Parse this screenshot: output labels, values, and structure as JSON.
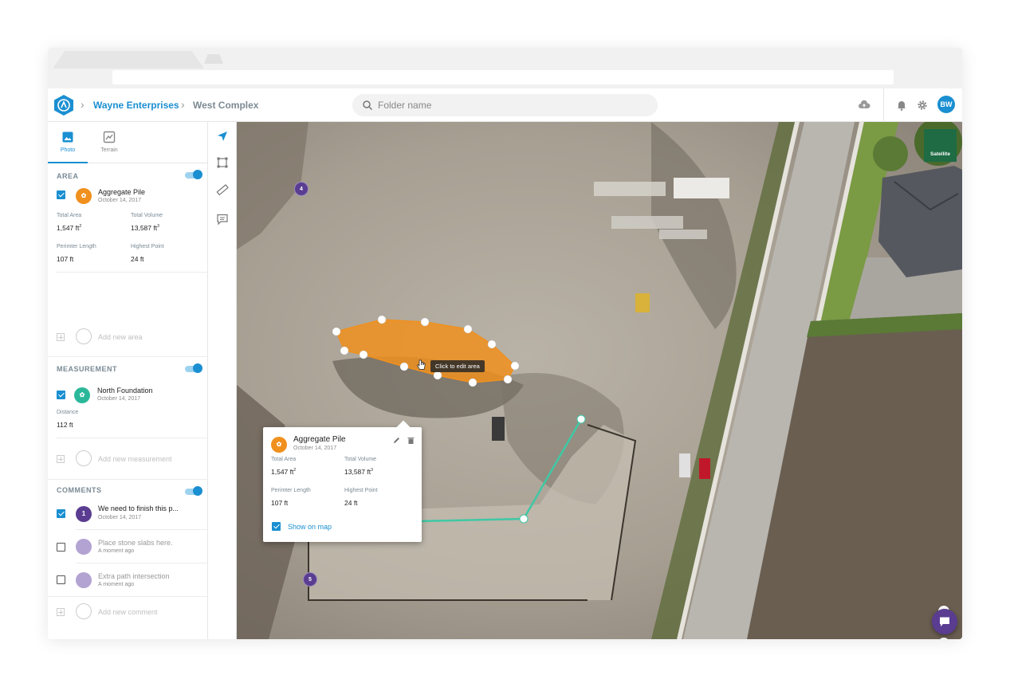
{
  "header": {
    "breadcrumb": [
      "Wayne Enterprises",
      "West Complex"
    ],
    "search_placeholder": "Folder name",
    "avatar_initials": "BW"
  },
  "sidebar": {
    "tabs": [
      {
        "label": "Photo",
        "active": true
      },
      {
        "label": "Terrain",
        "active": false
      }
    ],
    "area": {
      "title": "AREA",
      "enabled": true,
      "item": {
        "name": "Aggregate Pile",
        "date": "October 14, 2017",
        "checked": true,
        "color": "#f0901e",
        "metrics": [
          {
            "label": "Total Area",
            "value": "1,547 ft",
            "sup": "2"
          },
          {
            "label": "Total Volume",
            "value": "13,587 ft",
            "sup": "3"
          },
          {
            "label": "Perimter Length",
            "value": "107 ft"
          },
          {
            "label": "Highest Point",
            "value": "24 ft"
          }
        ]
      },
      "add_label": "Add new area"
    },
    "measurement": {
      "title": "MEASUREMENT",
      "enabled": true,
      "item": {
        "name": "North Foundation",
        "date": "October 14, 2017",
        "checked": true,
        "color": "#2bb89a",
        "metric_label": "Distance",
        "metric_value": "112 ft"
      },
      "add_label": "Add new measurement"
    },
    "comments": {
      "title": "COMMENTS",
      "enabled": true,
      "items": [
        {
          "number": "1",
          "text": "We need to finish this p...",
          "time": "October 14, 2017",
          "checked": true,
          "active": true
        },
        {
          "number": "",
          "text": "Place stone slabs here.",
          "time": "A moment ago",
          "checked": false,
          "active": false
        },
        {
          "number": "",
          "text": "Extra path intersection",
          "time": "A moment ago",
          "checked": false,
          "active": false
        }
      ],
      "add_label": "Add new comment"
    }
  },
  "map": {
    "satellite_label": "Satellite",
    "pins": [
      "4",
      "5"
    ],
    "tooltip": "Click to edit area",
    "area_color": "#f0901e",
    "line_color": "#3fc8a4",
    "zoom_controls": [
      "⌖",
      "+",
      "−"
    ]
  },
  "card": {
    "title": "Aggregate Pile",
    "date": "October 14, 2017",
    "metrics": [
      {
        "label": "Total Area",
        "value": "1,547 ft",
        "sup": "2"
      },
      {
        "label": "Total Volume",
        "value": "13,587 ft",
        "sup": "3"
      },
      {
        "label": "Perimter Length",
        "value": "107 ft"
      },
      {
        "label": "Highest Point",
        "value": "24 ft"
      }
    ],
    "show_on_map_label": "Show on map",
    "show_on_map_checked": true
  }
}
